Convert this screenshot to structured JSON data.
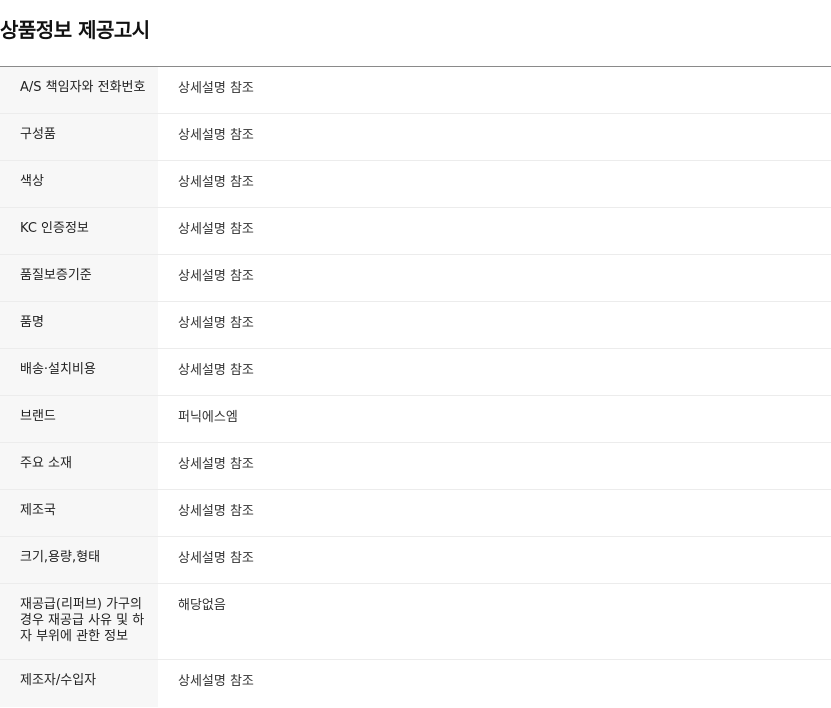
{
  "title": "상품정보 제공고시",
  "rows": [
    {
      "label": "A/S 책임자와 전화번호",
      "value": "상세설명 참조"
    },
    {
      "label": "구성품",
      "value": "상세설명 참조"
    },
    {
      "label": "색상",
      "value": "상세설명 참조"
    },
    {
      "label": "KC 인증정보",
      "value": "상세설명 참조"
    },
    {
      "label": "품질보증기준",
      "value": "상세설명 참조"
    },
    {
      "label": "품명",
      "value": "상세설명 참조"
    },
    {
      "label": "배송·설치비용",
      "value": "상세설명 참조"
    },
    {
      "label": "브랜드",
      "value": "퍼닉에스엠"
    },
    {
      "label": "주요 소재",
      "value": "상세설명 참조"
    },
    {
      "label": "제조국",
      "value": "상세설명 참조"
    },
    {
      "label": "크기,용량,형태",
      "value": "상세설명 참조"
    },
    {
      "label": "재공급(리퍼브) 가구의 경우 재공급 사유 및 하자 부위에 관한 정보",
      "value": "해당없음"
    },
    {
      "label": "제조자/수입자",
      "value": "상세설명 참조"
    }
  ]
}
